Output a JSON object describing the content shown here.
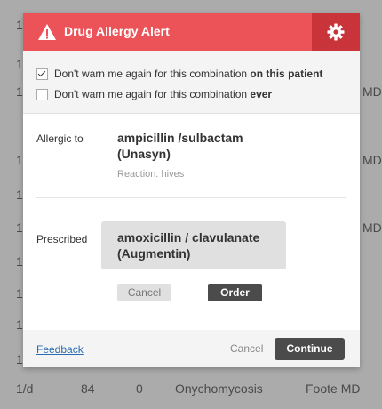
{
  "background_table": {
    "rows": [
      {
        "col1": "1",
        "col6": ""
      },
      {
        "col1": "1",
        "col6": ""
      },
      {
        "col1": "1",
        "col6": "MD"
      },
      {
        "col1": "1",
        "col6": "MD"
      },
      {
        "col1": "1",
        "col6": ""
      },
      {
        "col1": "1",
        "col6": "MD"
      },
      {
        "col1": "1",
        "col6": ""
      },
      {
        "col1": "1",
        "col6": ""
      },
      {
        "col1": "1",
        "col6": ""
      },
      {
        "col1": "1",
        "col6": ""
      },
      {
        "col1": "1",
        "col6": ""
      },
      {
        "col1": "1",
        "col6": "MD"
      },
      {
        "col1": "1",
        "col6": ""
      },
      {
        "col1": "1",
        "col6": ""
      },
      {
        "col1": "1",
        "col6": ""
      }
    ],
    "last_row": {
      "col1": "1/d",
      "col2": "84",
      "col3": "0",
      "col4": "Onychomycosis",
      "col5": "Foote MD"
    }
  },
  "modal": {
    "title": "Drug Allergy Alert",
    "header_color": "#eb5358",
    "options": [
      {
        "prefix": "Don't warn me again for this combination ",
        "emphasis": "on this patient",
        "checked": true
      },
      {
        "prefix": "Don't warn me again for this combination ",
        "emphasis": "ever",
        "checked": false
      }
    ],
    "allergy": {
      "label": "Allergic to",
      "drug_line1": "ampicillin /sulbactam",
      "drug_line2": "(Unasyn)",
      "reaction": "Reaction: hives"
    },
    "prescribed": {
      "label": "Prescribed",
      "drug_line1": "amoxicillin / clavulanate",
      "drug_line2": "(Augmentin)",
      "cancel_label": "Cancel",
      "order_label": "Order"
    },
    "footer": {
      "feedback_label": "Feedback",
      "cancel_label": "Cancel",
      "continue_label": "Continue"
    },
    "icons": {
      "header_left": "warning-icon",
      "header_right": "gear-icon"
    }
  }
}
